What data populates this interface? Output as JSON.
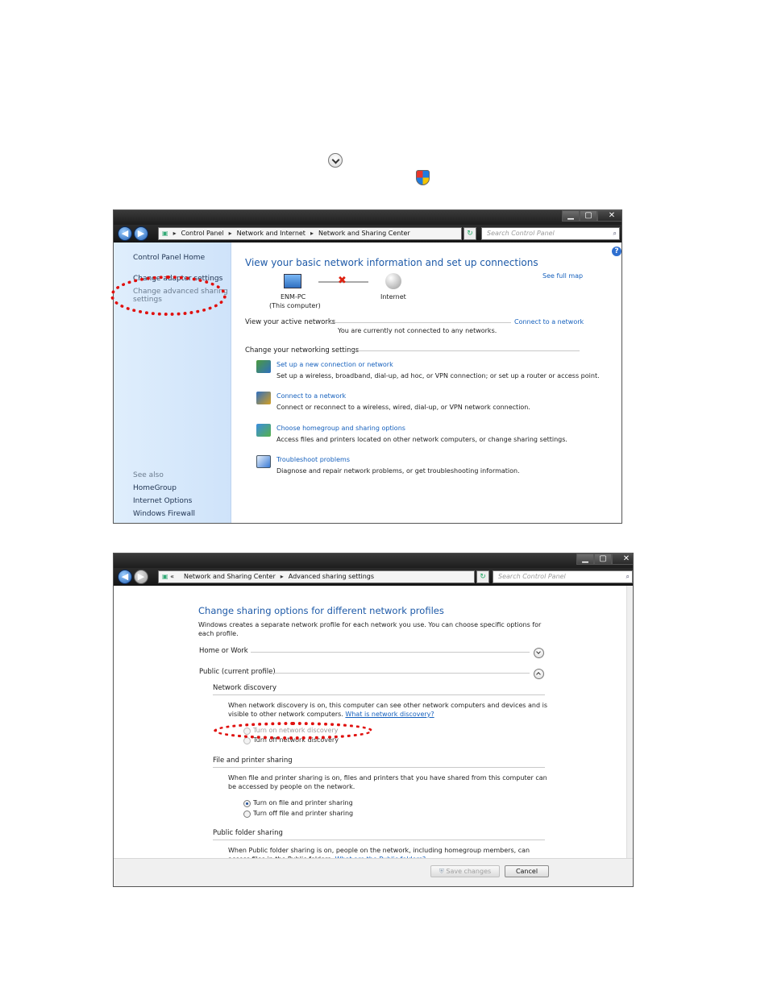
{
  "window1": {
    "breadcrumb": [
      "Control Panel",
      "Network and Internet",
      "Network and Sharing Center"
    ],
    "search_placeholder": "Search Control Panel",
    "sidebar": {
      "home": "Control Panel Home",
      "change_adapter": "Change adapter settings",
      "change_advanced_line1": "Change advanced sharing",
      "change_advanced_line2": "settings",
      "see_also": "See also",
      "links": [
        "HomeGroup",
        "Internet Options",
        "Windows Firewall"
      ]
    },
    "title": "View your basic network information and set up connections",
    "see_full_map": "See full map",
    "computer_name": "ENM-PC",
    "computer_sub": "(This computer)",
    "internet_label": "Internet",
    "active_networks_label": "View your active networks",
    "connect_link": "Connect to a network",
    "not_connected": "You are currently not connected to any networks.",
    "change_settings_label": "Change your networking settings",
    "tasks": [
      {
        "title": "Set up a new connection or network",
        "desc": "Set up a wireless, broadband, dial-up, ad hoc, or VPN connection; or set up a router or access point."
      },
      {
        "title": "Connect to a network",
        "desc": "Connect or reconnect to a wireless, wired, dial-up, or VPN network connection."
      },
      {
        "title": "Choose homegroup and sharing options",
        "desc": "Access files and printers located on other network computers, or change sharing settings."
      },
      {
        "title": "Troubleshoot problems",
        "desc": "Diagnose and repair network problems, or get troubleshooting information."
      }
    ]
  },
  "window2": {
    "breadcrumb_prefix": "«",
    "breadcrumb": [
      "Network and Sharing Center",
      "Advanced sharing settings"
    ],
    "search_placeholder": "Search Control Panel",
    "title": "Change sharing options for different network profiles",
    "intro_line1": "Windows creates a separate network profile for each network you use. You can choose specific options for",
    "intro_line2": "each profile.",
    "home_work": "Home or Work",
    "public_profile": "Public (current profile)",
    "network_discovery": {
      "heading": "Network discovery",
      "desc_line1": "When network discovery is on, this computer can see other network computers and devices and is",
      "desc_line2": "visible to other network computers.",
      "help_link": "What is network discovery?",
      "option_on": "Turn on network discovery",
      "option_off": "Turn off network discovery"
    },
    "file_printer": {
      "heading": "File and printer sharing",
      "desc_line1": "When file and printer sharing is on, files and printers that you have shared from this computer can",
      "desc_line2": "be accessed by people on the network.",
      "option_on": "Turn on file and printer sharing",
      "option_off": "Turn off file and printer sharing"
    },
    "public_folder": {
      "heading": "Public folder sharing",
      "desc_line1": "When Public folder sharing is on, people on the network, including homegroup members, can",
      "desc_line2": "access files in the Public folders.",
      "help_link": "What are the Public folders?"
    },
    "save_button": "Save changes",
    "cancel_button": "Cancel"
  },
  "colors": {
    "highlight": "#e0100e",
    "link": "#1560bd",
    "sidebar": "#d6e8fb"
  }
}
